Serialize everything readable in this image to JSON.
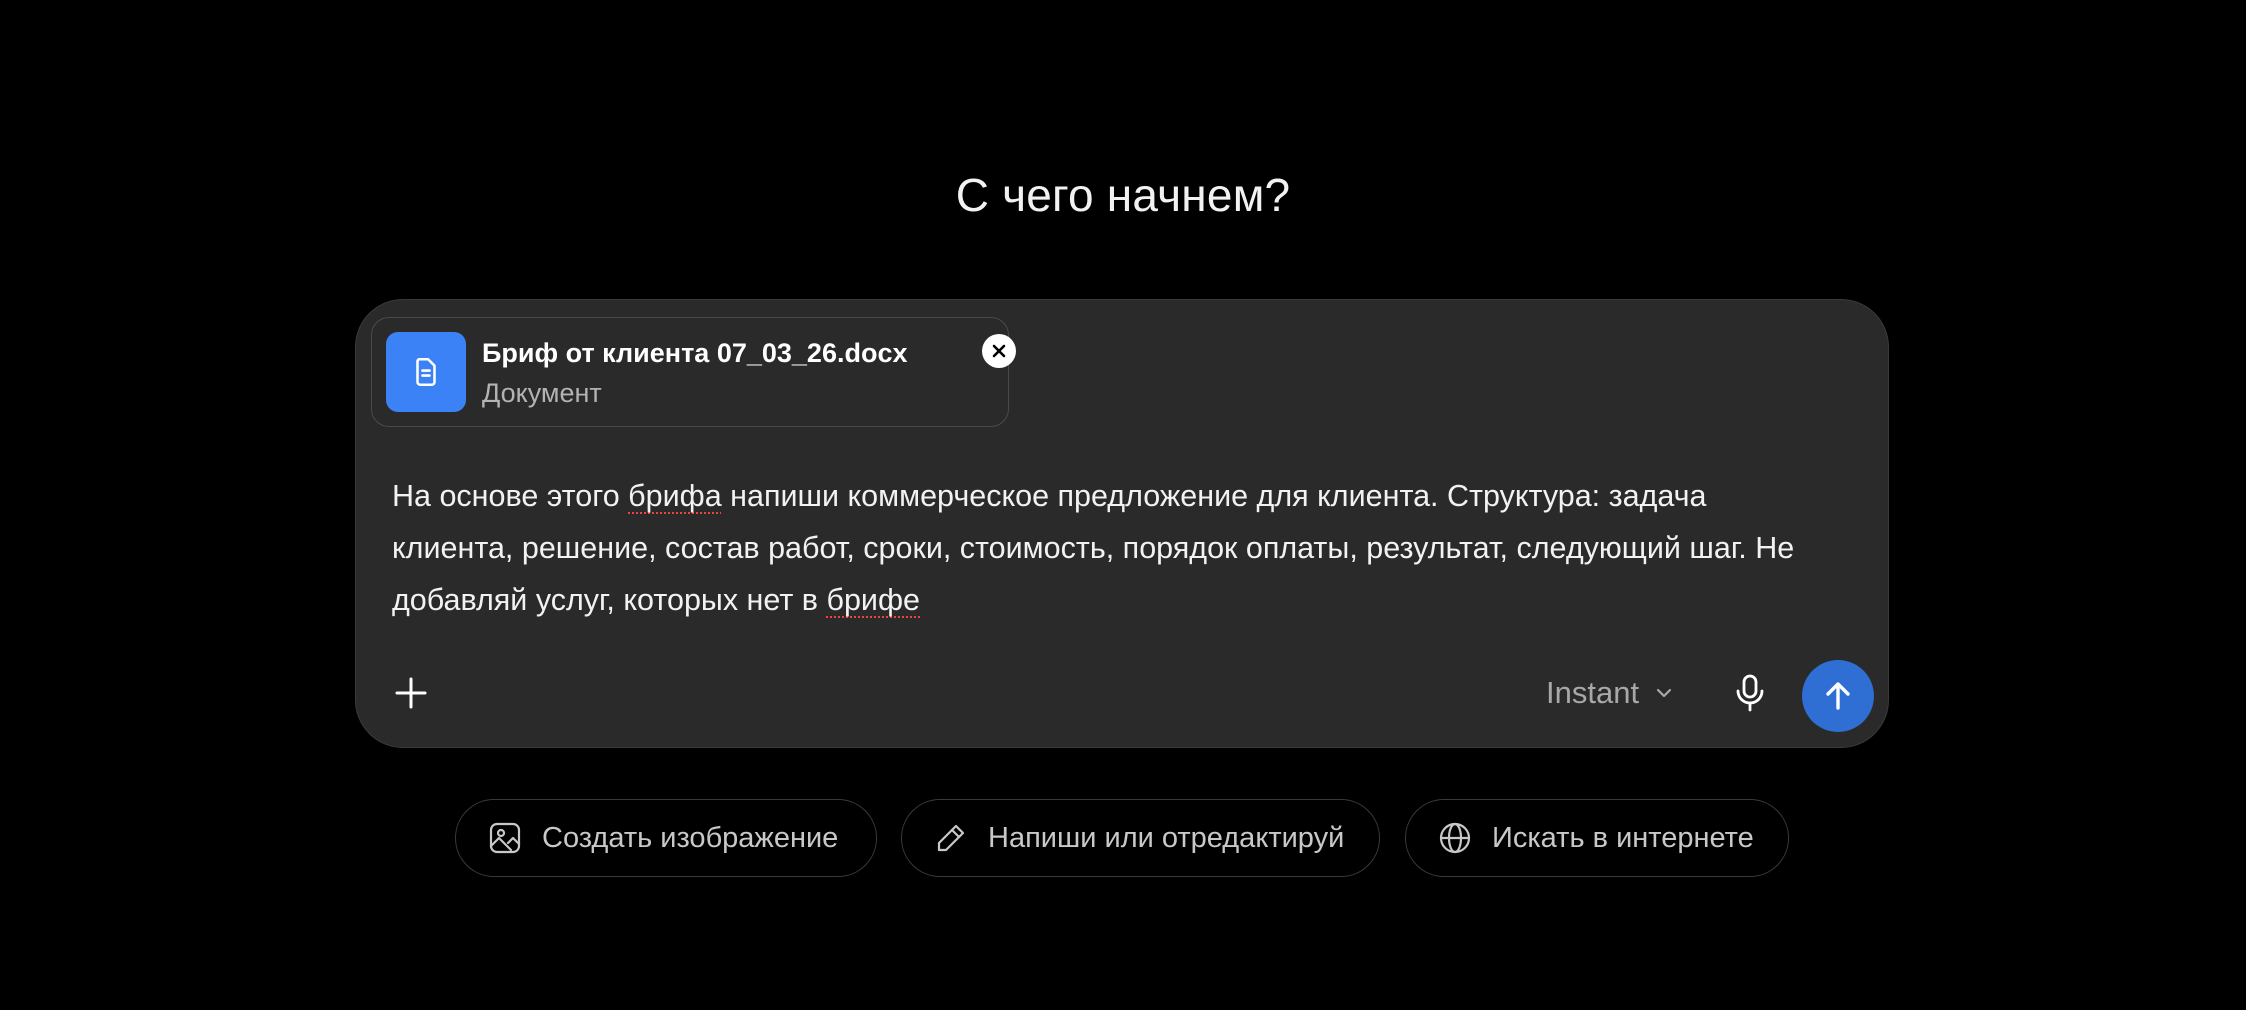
{
  "heading": "С чего начнем?",
  "composer": {
    "attachment": {
      "file_name": "Бриф от клиента 07_03_26.docx",
      "file_type": "Документ",
      "icon": "document-icon",
      "icon_color": "#3b82f6"
    },
    "prompt": {
      "part1": "На основе этого ",
      "word1": "брифа",
      "part2": " напиши коммерческое предложение для клиента. Структура: задача клиента, решение, состав работ, сроки, стоимость, порядок оплаты, результат, следующий шаг. Не добавляй услуг, которых нет в ",
      "word2": "брифе"
    },
    "model_label": "Instant",
    "send_color": "#2f6fd4"
  },
  "suggestions": [
    {
      "label": "Создать изображение",
      "icon": "image-icon"
    },
    {
      "label": "Напиши или отредактируй",
      "icon": "pencil-icon"
    },
    {
      "label": "Искать в интернете",
      "icon": "globe-icon"
    }
  ]
}
